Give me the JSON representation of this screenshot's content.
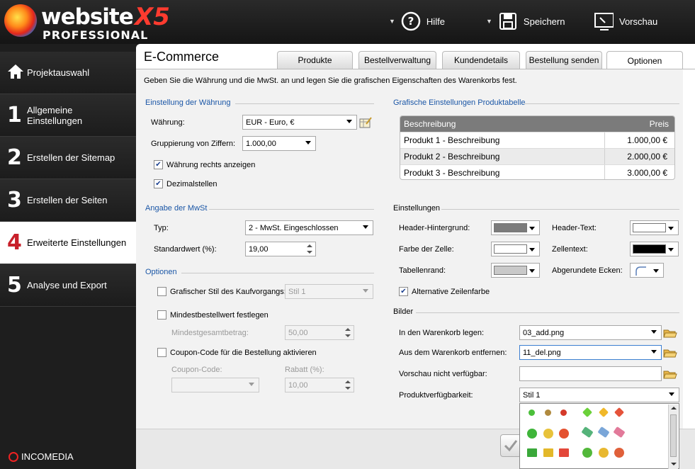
{
  "app": {
    "name": "website",
    "version": "X5",
    "edition": "PROFESSIONAL",
    "brand": "INCOMEDIA"
  },
  "toolbar": {
    "help": "Hilfe",
    "save": "Speichern",
    "preview": "Vorschau"
  },
  "sidebar": {
    "items": [
      {
        "num": "",
        "label": "Projektauswahl"
      },
      {
        "num": "1",
        "label": "Allgemeine Einstellungen"
      },
      {
        "num": "2",
        "label": "Erstellen der Sitemap"
      },
      {
        "num": "3",
        "label": "Erstellen der Seiten"
      },
      {
        "num": "4",
        "label": "Erweiterte Einstellungen"
      },
      {
        "num": "5",
        "label": "Analyse und Export"
      }
    ]
  },
  "panel": {
    "title": "E-Commerce",
    "tabs": [
      "Produkte",
      "Bestellverwaltung",
      "Kundendetails",
      "Bestellung senden",
      "Optionen"
    ],
    "active_tab": "Optionen",
    "description": "Geben Sie die Währung und die MwSt. an und legen Sie die grafischen Eigenschaften des Warenkorbs fest."
  },
  "currency": {
    "section": "Einstellung der Währung",
    "currency_label": "Währung:",
    "currency_value": "EUR - Euro, €",
    "grouping_label": "Gruppierung von Ziffern:",
    "grouping_value": "1.000,00",
    "right_label": "Währung rechts anzeigen",
    "right_checked": "✔",
    "decimals_label": "Dezimalstellen",
    "decimals_checked": "✔"
  },
  "vat": {
    "section": "Angabe der MwSt",
    "type_label": "Typ:",
    "type_value": "2 - MwSt. Eingeschlossen",
    "default_label": "Standardwert (%):",
    "default_value": "19,00"
  },
  "options": {
    "section": "Optionen",
    "style_label": "Grafischer Stil des Kaufvorgangs:",
    "style_value": "Stil 1",
    "min_label": "Mindestbestellwert festlegen",
    "min_amount_label": "Mindestgesamtbetrag:",
    "min_amount_value": "50,00",
    "coupon_label": "Coupon-Code für die Bestellung aktivieren",
    "coupon_code_label": "Coupon-Code:",
    "coupon_code_value": "",
    "discount_label": "Rabatt (%):",
    "discount_value": "10,00"
  },
  "table_style": {
    "section": "Grafische Einstellungen Produktabelle",
    "col1": "Beschreibung",
    "col2": "Preis",
    "rows": [
      {
        "desc": "Produkt 1 - Beschreibung",
        "price": "1.000,00 €"
      },
      {
        "desc": "Produkt 2 - Beschreibung",
        "price": "2.000,00 €"
      },
      {
        "desc": "Produkt 3 - Beschreibung",
        "price": "3.000,00 €"
      }
    ]
  },
  "settings": {
    "section": "Einstellungen",
    "header_bg": "Header-Hintergrund:",
    "header_text": "Header-Text:",
    "cell_color": "Farbe der Zelle:",
    "cell_text": "Zellentext:",
    "border": "Tabellenrand:",
    "rounded": "Abgerundete Ecken:",
    "alt_row": "Alternative Zeilenfarbe",
    "alt_row_checked": "✔"
  },
  "colors": {
    "header_bg": "#7b7b7b",
    "header_text": "#ffffff",
    "cell": "#ffffff",
    "cell_text": "#000000",
    "border": "#c9c9c9",
    "accent": "#1a56a6",
    "active_num": "#c8202a"
  },
  "images": {
    "section": "Bilder",
    "add_label": "In den Warenkorb legen:",
    "add_value": "03_add.png",
    "remove_label": "Aus dem Warenkorb entfernen:",
    "remove_value": "11_del.png",
    "unavailable_label": "Vorschau nicht verfügbar:",
    "unavailable_value": "",
    "availability_label": "Produktverfügbarkeit:",
    "availability_value": "Stil 1"
  }
}
